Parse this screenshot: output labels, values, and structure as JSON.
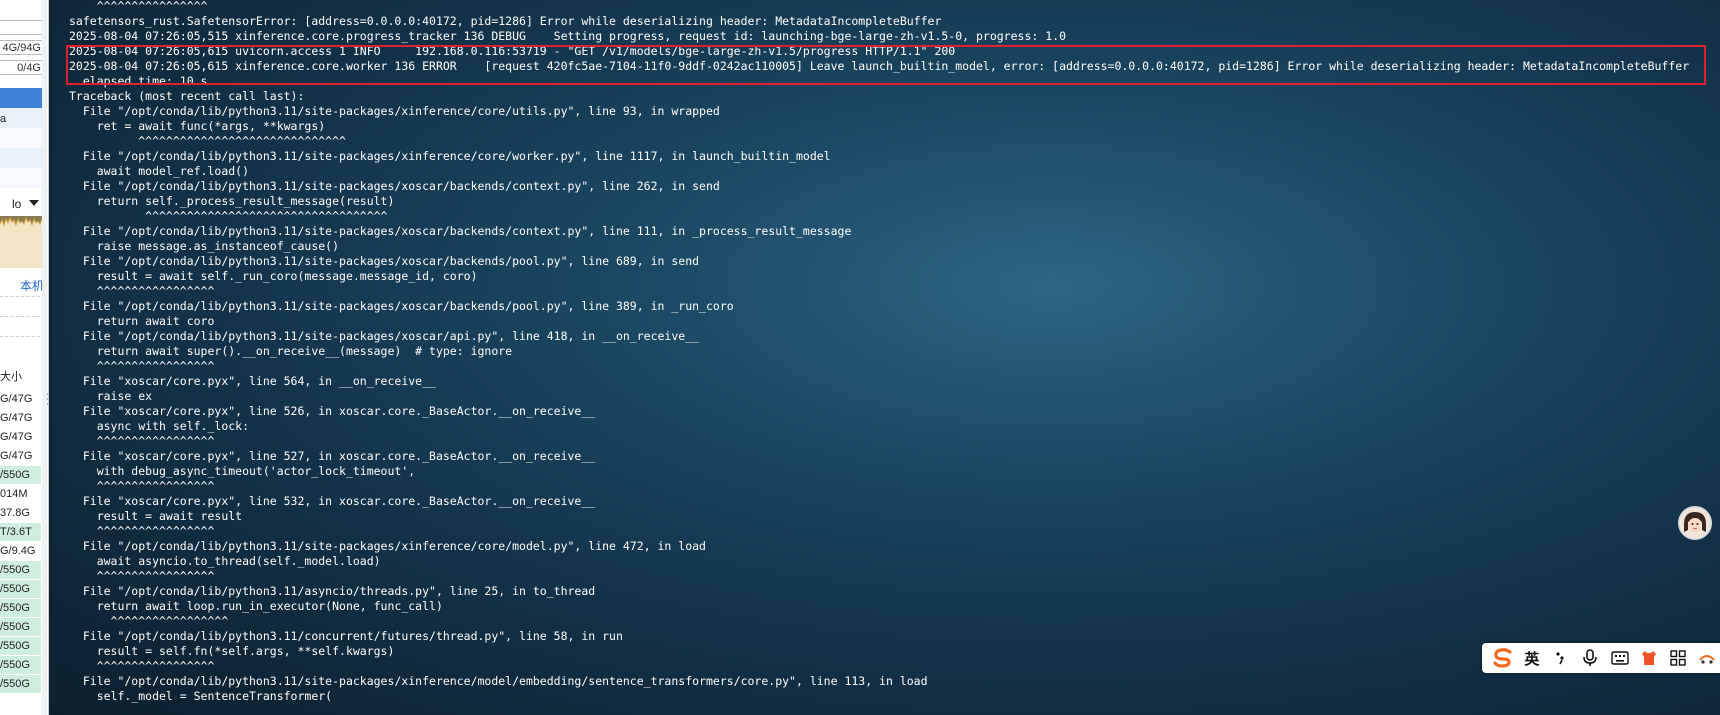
{
  "sidebar": {
    "box1": "",
    "box2": "4G/94G",
    "box3": "0/4G",
    "row_text": "a",
    "dropdown_label": "lo",
    "link": "本机",
    "size_header": "大小",
    "sizes": [
      "G/47G",
      "G/47G",
      "G/47G",
      "G/47G",
      "/550G",
      "014M",
      "37.8G",
      "T/3.6T",
      "G/9.4G",
      "/550G",
      "/550G",
      "/550G",
      "/550G",
      "/550G",
      "/550G",
      "/550G"
    ],
    "size_highlight": [
      false,
      false,
      false,
      false,
      true,
      false,
      false,
      true,
      false,
      true,
      true,
      true,
      true,
      true,
      true,
      true
    ]
  },
  "terminal": {
    "lines": [
      "    ^^^^^^^^^^^^^^^^",
      "safetensors_rust.SafetensorError: [address=0.0.0.0:40172, pid=1286] Error while deserializing header: MetadataIncompleteBuffer",
      "2025-08-04 07:26:05,515 xinference.core.progress_tracker 136 DEBUG    Setting progress, request id: launching-bge-large-zh-v1.5-0, progress: 1.0",
      "2025-08-04 07:26:05,615 uvicorn.access 1 INFO     192.168.0.116:53719 - \"GET /v1/models/bge-large-zh-v1.5/progress HTTP/1.1\" 200",
      "2025-08-04 07:26:05,615 xinference.core.worker 136 ERROR    [request 420fc5ae-7104-11f0-9ddf-0242ac110005] Leave launch_builtin_model, error: [address=0.0.0.0:40172, pid=1286] Error while deserializing header: MetadataIncompleteBuffer",
      "  elapsed time: 10 s",
      "Traceback (most recent call last):",
      "  File \"/opt/conda/lib/python3.11/site-packages/xinference/core/utils.py\", line 93, in wrapped",
      "    ret = await func(*args, **kwargs)",
      "          ^^^^^^^^^^^^^^^^^^^^^^^^^^^^^^",
      "  File \"/opt/conda/lib/python3.11/site-packages/xinference/core/worker.py\", line 1117, in launch_builtin_model",
      "    await model_ref.load()",
      "  File \"/opt/conda/lib/python3.11/site-packages/xoscar/backends/context.py\", line 262, in send",
      "    return self._process_result_message(result)",
      "           ^^^^^^^^^^^^^^^^^^^^^^^^^^^^^^^^^^^",
      "  File \"/opt/conda/lib/python3.11/site-packages/xoscar/backends/context.py\", line 111, in _process_result_message",
      "    raise message.as_instanceof_cause()",
      "  File \"/opt/conda/lib/python3.11/site-packages/xoscar/backends/pool.py\", line 689, in send",
      "    result = await self._run_coro(message.message_id, coro)",
      "    ^^^^^^^^^^^^^^^^^",
      "  File \"/opt/conda/lib/python3.11/site-packages/xoscar/backends/pool.py\", line 389, in _run_coro",
      "    return await coro",
      "  File \"/opt/conda/lib/python3.11/site-packages/xoscar/api.py\", line 418, in __on_receive__",
      "    return await super().__on_receive__(message)  # type: ignore",
      "    ^^^^^^^^^^^^^^^^^",
      "  File \"xoscar/core.pyx\", line 564, in __on_receive__",
      "    raise ex",
      "  File \"xoscar/core.pyx\", line 526, in xoscar.core._BaseActor.__on_receive__",
      "    async with self._lock:",
      "    ^^^^^^^^^^^^^^^^^",
      "  File \"xoscar/core.pyx\", line 527, in xoscar.core._BaseActor.__on_receive__",
      "    with debug_async_timeout('actor_lock_timeout',",
      "    ^^^^^^^^^^^^^^^^^",
      "  File \"xoscar/core.pyx\", line 532, in xoscar.core._BaseActor.__on_receive__",
      "    result = await result",
      "    ^^^^^^^^^^^^^^^^^",
      "  File \"/opt/conda/lib/python3.11/site-packages/xinference/core/model.py\", line 472, in load",
      "    await asyncio.to_thread(self._model.load)",
      "    ^^^^^^^^^^^^^^^^^",
      "  File \"/opt/conda/lib/python3.11/asyncio/threads.py\", line 25, in to_thread",
      "    return await loop.run_in_executor(None, func_call)",
      "      ^^^^^^^^^^^^^^^^^",
      "  File \"/opt/conda/lib/python3.11/concurrent/futures/thread.py\", line 58, in run",
      "    result = self.fn(*self.args, **self.kwargs)",
      "    ^^^^^^^^^^^^^^^^^",
      "  File \"/opt/conda/lib/python3.11/site-packages/xinference/model/embedding/sentence_transformers/core.py\", line 113, in load",
      "    self._model = SentenceTransformer("
    ]
  },
  "ime": {
    "logo": "S",
    "lang": "英",
    "items": [
      "punctuation-icon",
      "microphone-icon",
      "keyboard-icon",
      "skin-icon",
      "grid-icon",
      "more-icon"
    ]
  },
  "colors": {
    "highlight": "#e02030",
    "text": "#ffffff",
    "selection": "#3d82d6",
    "ime_logo": "#f26b1d"
  }
}
